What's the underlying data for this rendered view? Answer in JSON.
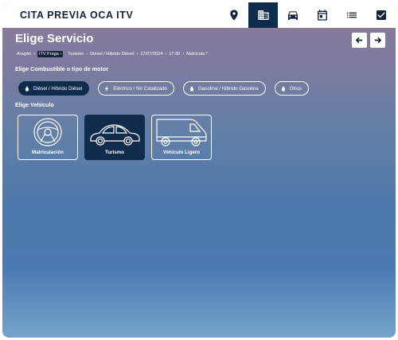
{
  "app": {
    "title": "CITA PREVIA OCA ITV"
  },
  "nav": [
    {
      "name": "location",
      "icon": "map-pin-icon",
      "active": false
    },
    {
      "name": "station",
      "icon": "building-icon",
      "active": true
    },
    {
      "name": "vehicle",
      "icon": "car-icon",
      "active": false
    },
    {
      "name": "date",
      "icon": "calendar-icon",
      "active": false
    },
    {
      "name": "summary",
      "icon": "list-icon",
      "active": false
    },
    {
      "name": "confirm",
      "icon": "checkbox-icon",
      "active": false
    }
  ],
  "page": {
    "title": "Elige Servicio"
  },
  "breadcrumb": [
    {
      "label": "Aragón",
      "highlighted": false
    },
    {
      "label": "ITV Fraga",
      "highlighted": true
    },
    {
      "label": "Turismo",
      "highlighted": false
    },
    {
      "label": "Diésel / Híbrido Diésel",
      "highlighted": false
    },
    {
      "label": "17/07/2024",
      "highlighted": false
    },
    {
      "label": "17:30",
      "highlighted": false
    },
    {
      "label": "Matrícula *",
      "highlighted": false
    }
  ],
  "fuel": {
    "heading": "Elige Combustible o tipo de motor",
    "options": [
      {
        "label": "Diésel / Híbrido Diésel",
        "selected": true
      },
      {
        "label": "Eléctrico / No Catalizado",
        "selected": false
      },
      {
        "label": "Gasolina / Híbrido Gasolina",
        "selected": false
      },
      {
        "label": "Otros",
        "selected": false
      }
    ]
  },
  "vehicle": {
    "heading": "Elige Vehículo",
    "options": [
      {
        "label": "Matriculación",
        "icon": "steering-wheel-icon",
        "selected": false
      },
      {
        "label": "Turismo",
        "icon": "car-side-icon",
        "selected": true
      },
      {
        "label": "Vehículo Ligero",
        "icon": "van-icon",
        "selected": false
      }
    ]
  },
  "colors": {
    "primary": "#102c4d",
    "text_dark": "#14223a",
    "white": "#ffffff"
  }
}
